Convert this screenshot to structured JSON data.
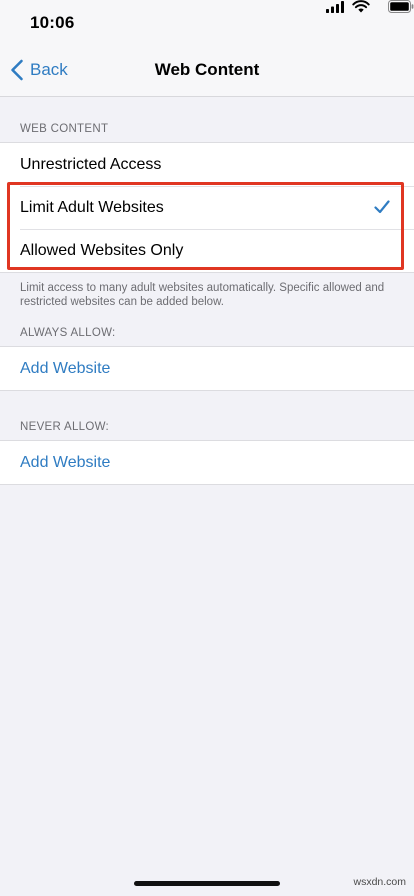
{
  "status_bar": {
    "time": "10:06",
    "icons": [
      "cellular-signal-icon",
      "wifi-icon",
      "battery-icon"
    ]
  },
  "nav": {
    "back_label": "Back",
    "title": "Web Content"
  },
  "web_content": {
    "header": "WEB CONTENT",
    "options": [
      {
        "label": "Unrestricted Access",
        "selected": false
      },
      {
        "label": "Limit Adult Websites",
        "selected": true
      },
      {
        "label": "Allowed Websites Only",
        "selected": false
      }
    ],
    "footer": "Limit access to many adult websites automatically. Specific allowed and restricted websites can be added below."
  },
  "always_allow": {
    "header": "ALWAYS ALLOW:",
    "add_label": "Add Website"
  },
  "never_allow": {
    "header": "NEVER ALLOW:",
    "add_label": "Add Website"
  },
  "watermark": "wsxdn.com",
  "colors": {
    "accent": "#2f7cc2",
    "highlight": "#e03622",
    "background": "#f2f2f7"
  }
}
